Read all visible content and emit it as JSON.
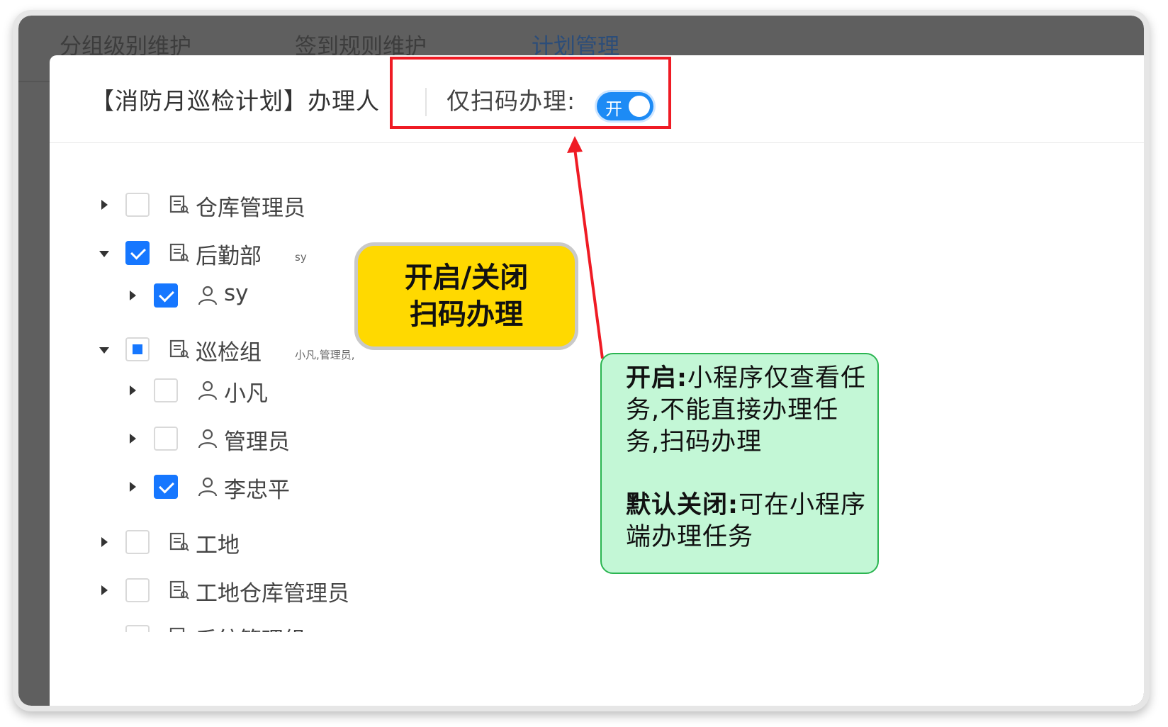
{
  "background_tabs": [
    "分组级别维护",
    "签到规则维护",
    "计划管理"
  ],
  "modal": {
    "title": "【消防月巡检计划】办理人",
    "scan_only_label": "仅扫码办理:",
    "toggle_text": "开"
  },
  "tree": [
    {
      "label": "仓库管理员",
      "type": "group",
      "checked": "none",
      "expanded": false,
      "sub": ""
    },
    {
      "label": "后勤部",
      "type": "group",
      "checked": "full",
      "expanded": true,
      "sub": "sy"
    },
    {
      "label": "sy",
      "type": "user",
      "checked": "full",
      "expanded": false,
      "sub": ""
    },
    {
      "label": "巡检组",
      "type": "group",
      "checked": "partial",
      "expanded": true,
      "sub": "小凡,管理员,"
    },
    {
      "label": "小凡",
      "type": "user",
      "checked": "none",
      "expanded": false,
      "sub": ""
    },
    {
      "label": "管理员",
      "type": "user",
      "checked": "none",
      "expanded": false,
      "sub": ""
    },
    {
      "label": "李忠平",
      "type": "user",
      "checked": "full",
      "expanded": false,
      "sub": ""
    },
    {
      "label": "工地",
      "type": "group",
      "checked": "none",
      "expanded": false,
      "sub": ""
    },
    {
      "label": "工地仓库管理员",
      "type": "group",
      "checked": "none",
      "expanded": false,
      "sub": ""
    },
    {
      "label": "系统管理组",
      "type": "group",
      "checked": "none",
      "expanded": false,
      "sub": ""
    }
  ],
  "callout_yellow": {
    "line1": "开启/关闭",
    "line2": "扫码办理"
  },
  "callout_green": {
    "p1_bold": "开启:",
    "p1_text": "小程序仅查看任务,不能直接办理任务,扫码办理",
    "p2_bold": "默认关闭:",
    "p2_text": "可在小程序端办理任务"
  },
  "colors": {
    "accent": "#1677ff",
    "highlight": "#ef1b24",
    "yellow": "#ffd900",
    "green": "#c3f7d6"
  }
}
